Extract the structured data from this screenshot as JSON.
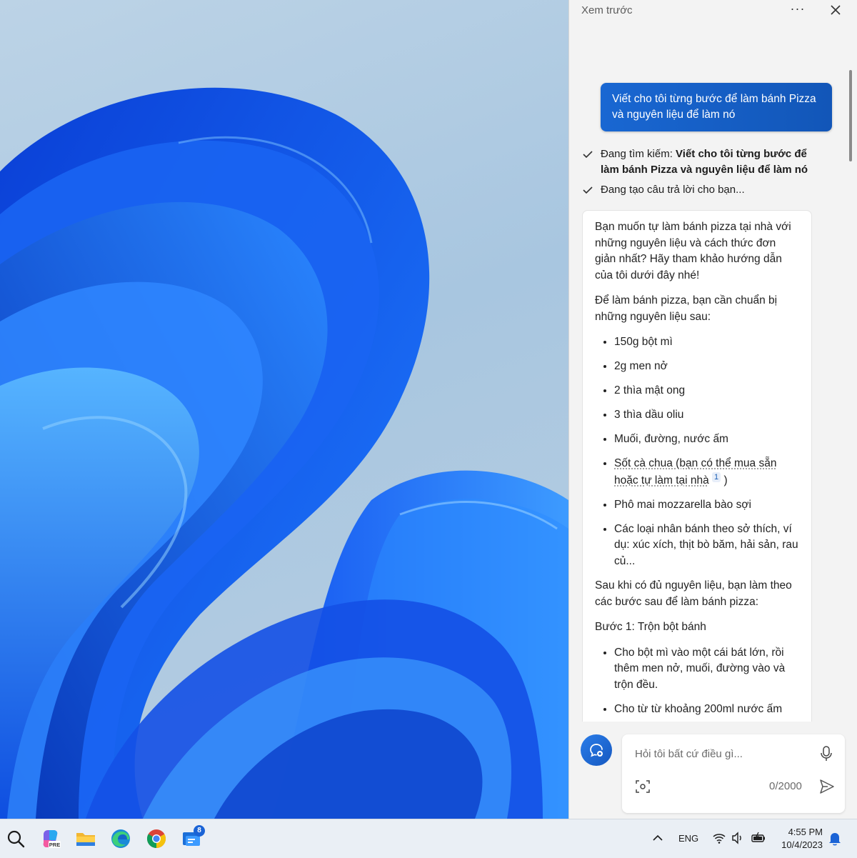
{
  "panel": {
    "title": "Xem trước",
    "more_icon": "more-horizontal-icon",
    "close_icon": "close-icon"
  },
  "user_message": "Viết cho tôi từng bước để làm bánh Pizza và nguyên liệu để làm nó",
  "status": {
    "searching_label": "Đang tìm kiếm:",
    "searching_query": "Viết cho tôi từng bước để làm bánh Pizza và nguyên liệu để làm nó",
    "generating": "Đang tạo câu trả lời cho bạn..."
  },
  "answer": {
    "intro": "Bạn muốn tự làm bánh pizza tại nhà với những nguyên liệu và cách thức đơn giản nhất? Hãy tham khảo hướng dẫn của tôi dưới đây nhé!",
    "ingredients_intro": "Để làm bánh pizza, bạn cần chuẩn bị những nguyên liệu sau:",
    "ingredients": [
      "150g bột mì",
      "2g men nở",
      "2 thìa mật ong",
      "3 thìa dầu oliu",
      "Muối, đường, nước ấm"
    ],
    "sauce_item": "Sốt cà chua (bạn có thể mua sẵn hoặc tự làm tại nhà",
    "sauce_cite": "1",
    "sauce_close": ")",
    "ingredients_more": [
      "Phô mai mozzarella bào sợi",
      "Các loại nhân bánh theo sở thích, ví dụ: xúc xích, thịt bò băm, hải sản, rau củ..."
    ],
    "steps_intro": "Sau khi có đủ nguyên liệu, bạn làm theo các bước sau để làm bánh pizza:",
    "step1_title": "Bước 1: Trộn bột bánh",
    "step1_items": [
      "Cho bột mì vào một cái bát lớn, rồi thêm men nở, muối, đường vào và trộn đều.",
      "Cho từ từ khoảng 200ml nước ấm"
    ]
  },
  "composer": {
    "placeholder": "Hỏi tôi bất cứ điều gì...",
    "char_count": "0/2000",
    "new_topic_icon": "new-topic-icon",
    "mic_icon": "microphone-icon",
    "screenshot_icon": "screenshot-icon",
    "send_icon": "send-icon"
  },
  "taskbar": {
    "icons": [
      "search-icon",
      "copilot-pre-icon",
      "file-explorer-icon",
      "edge-icon",
      "chrome-icon",
      "app-badge-icon"
    ],
    "badge_count": "8",
    "language": "ENG",
    "time": "4:55 PM",
    "date": "10/4/2023"
  },
  "colors": {
    "accent": "#1967d2",
    "panel_bg": "#f3f3f3",
    "taskbar_bg": "#eaeff5"
  }
}
